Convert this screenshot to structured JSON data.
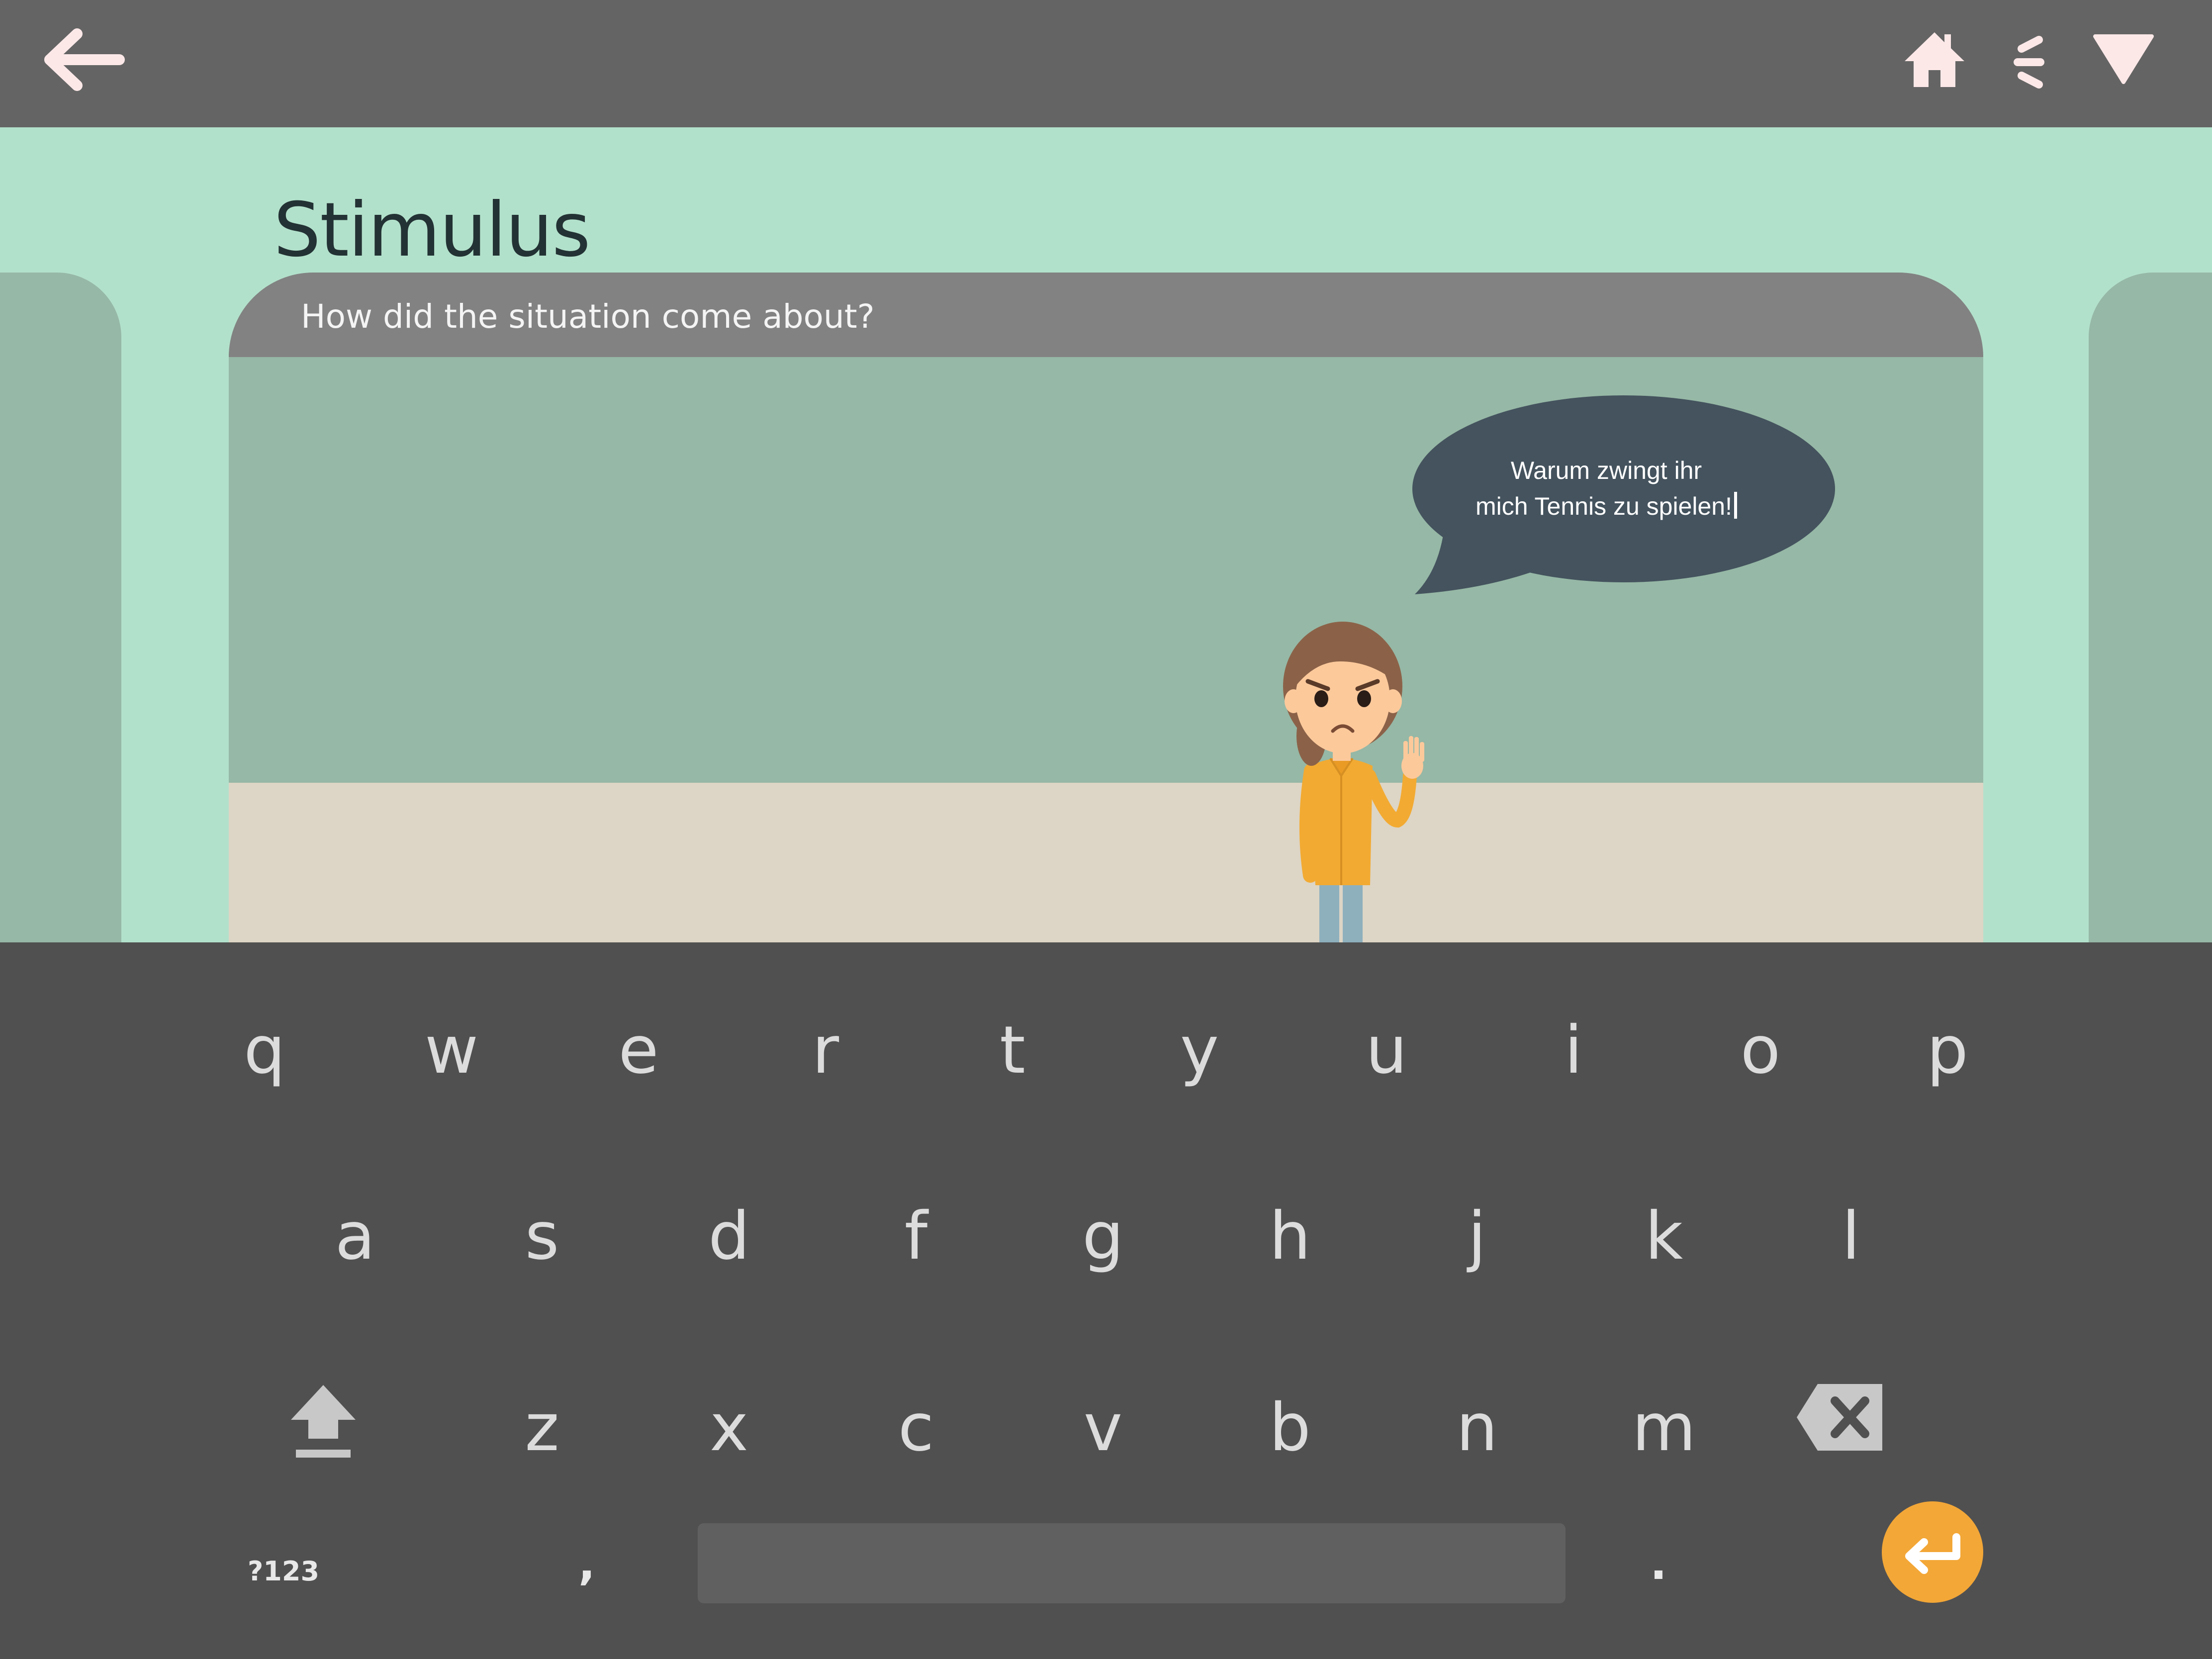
{
  "topbar": {
    "back_icon": "arrow-left-icon",
    "home_icon": "home-icon",
    "menu_icon": "menu-lines-icon",
    "dropdown_icon": "triangle-down-icon",
    "icon_color": "#fde8e8"
  },
  "page": {
    "title": "Stimulus"
  },
  "card": {
    "question": "How did the situation come about?"
  },
  "speech_bubble": {
    "line1": "Warum zwingt ihr",
    "line2": "mich Tennis zu spielen!"
  },
  "keyboard": {
    "row1": [
      "q",
      "w",
      "e",
      "r",
      "t",
      "y",
      "u",
      "i",
      "o",
      "p"
    ],
    "row2": [
      "a",
      "s",
      "d",
      "f",
      "g",
      "h",
      "j",
      "k",
      "l"
    ],
    "row3": [
      "z",
      "x",
      "c",
      "v",
      "b",
      "n",
      "m"
    ],
    "shift_icon": "shift-arrow-icon",
    "backspace_icon": "backspace-icon",
    "symbols_label": "?123",
    "comma_label": ",",
    "period_label": ".",
    "enter_icon": "enter-return-icon",
    "enter_color": "#f3a737"
  },
  "colors": {
    "topbar": "#646464",
    "background": "#b2e1cb",
    "card_header": "#828282",
    "scene_wall": "#96b8a6",
    "scene_floor": "#ddd5c5",
    "bubble": "#44535e",
    "keyboard": "#505050"
  }
}
